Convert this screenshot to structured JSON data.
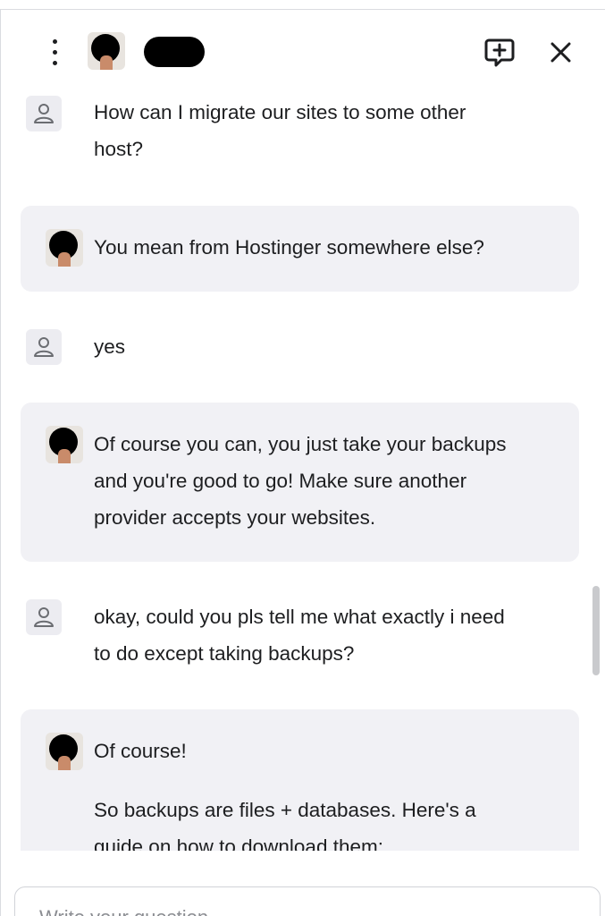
{
  "header": {
    "menu_icon": "vertical-ellipsis-icon",
    "new_chat_icon": "message-plus-icon",
    "close_icon": "close-icon"
  },
  "messages": [
    {
      "sender": "user",
      "text_lines": [
        "How can I migrate our sites to some other",
        "host?"
      ]
    },
    {
      "sender": "assistant",
      "text_lines": [
        "You mean from Hostinger somewhere else?"
      ]
    },
    {
      "sender": "user",
      "text_lines": [
        "yes"
      ]
    },
    {
      "sender": "assistant",
      "text_lines": [
        "Of course you can, you just take your backups",
        "and you're good to go! Make sure another",
        "provider accepts your websites."
      ]
    },
    {
      "sender": "user",
      "text_lines": [
        "okay, could you pls tell me what exactly i need",
        "to do except taking backups?"
      ]
    },
    {
      "sender": "assistant",
      "text_lines": [
        "Of course!",
        "So backups are files + databases. Here's a",
        "guide on how to download them:"
      ]
    }
  ],
  "input": {
    "placeholder": "Write your question",
    "value": ""
  },
  "colors": {
    "bot_bubble": "#f1f1f5",
    "user_icon_bg": "#ececf1",
    "text": "#1d1e20"
  }
}
